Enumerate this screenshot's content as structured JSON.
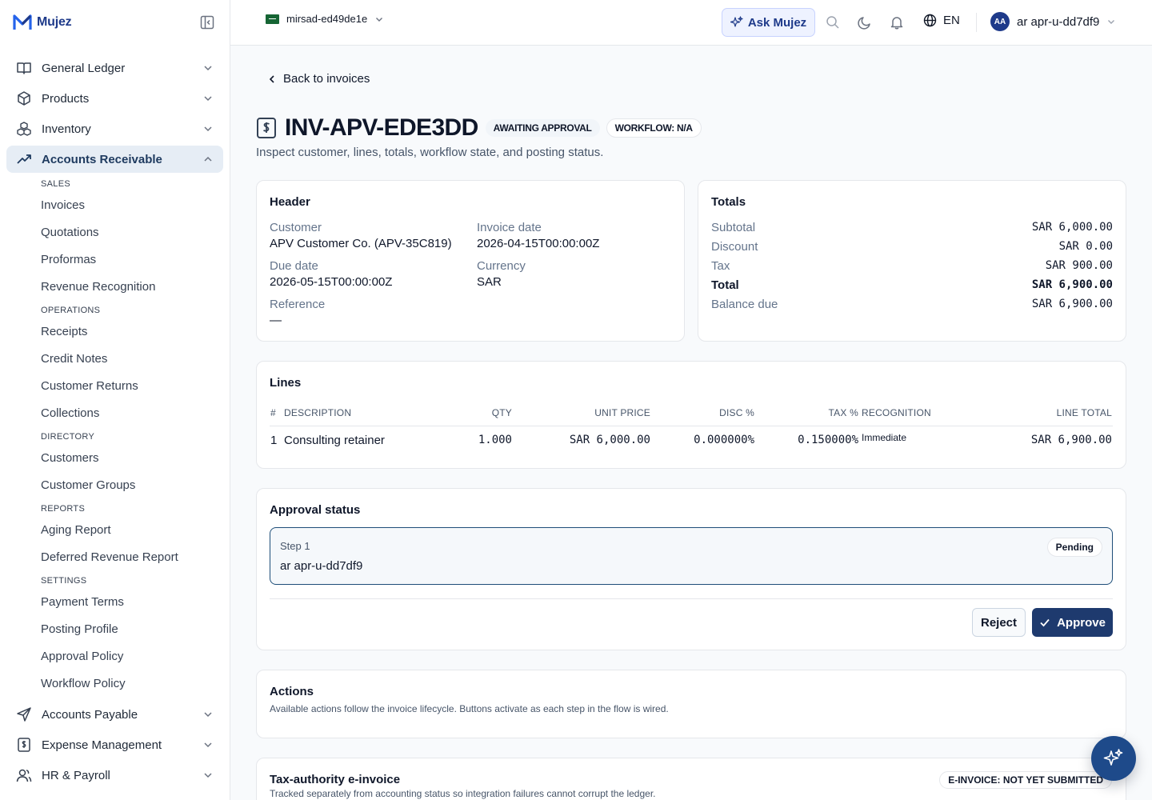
{
  "brand": {
    "name": "Mujez"
  },
  "sidebar": {
    "items": [
      {
        "label": "General Ledger",
        "icon": "book-icon"
      },
      {
        "label": "Products",
        "icon": "box-icon"
      },
      {
        "label": "Inventory",
        "icon": "boxes-icon"
      },
      {
        "label": "Accounts Receivable",
        "icon": "trending-up-icon",
        "active": true
      }
    ],
    "ar_groups": [
      {
        "label": "SALES",
        "items": [
          "Invoices",
          "Quotations",
          "Proformas",
          "Revenue Recognition"
        ]
      },
      {
        "label": "OPERATIONS",
        "items": [
          "Receipts",
          "Credit Notes",
          "Customer Returns",
          "Collections"
        ]
      },
      {
        "label": "DIRECTORY",
        "items": [
          "Customers",
          "Customer Groups"
        ]
      },
      {
        "label": "REPORTS",
        "items": [
          "Aging Report",
          "Deferred Revenue Report"
        ]
      },
      {
        "label": "SETTINGS",
        "items": [
          "Payment Terms",
          "Posting Profile",
          "Approval Policy",
          "Workflow Policy"
        ]
      }
    ],
    "bottom_items": [
      {
        "label": "Accounts Payable",
        "icon": "send-icon"
      },
      {
        "label": "Expense Management",
        "icon": "receipt-icon"
      },
      {
        "label": "HR & Payroll",
        "icon": "users-icon"
      }
    ]
  },
  "topbar": {
    "org": "mirsad-ed49de1e",
    "ask_label": "Ask Mujez",
    "language": "EN",
    "avatar_initials": "AA",
    "user_name": "ar apr-u-dd7df9"
  },
  "page": {
    "back_label": "Back to invoices",
    "title": "INV-APV-EDE3DD",
    "status_badge": "AWAITING APPROVAL",
    "workflow_badge": "WORKFLOW: N/A",
    "subtitle": "Inspect customer, lines, totals, workflow state, and posting status."
  },
  "header_card": {
    "title": "Header",
    "customer_label": "Customer",
    "customer_value": "APV Customer Co. (APV-35C819)",
    "invoice_date_label": "Invoice date",
    "invoice_date_value": "2026-04-15T00:00:00Z",
    "due_date_label": "Due date",
    "due_date_value": "2026-05-15T00:00:00Z",
    "currency_label": "Currency",
    "currency_value": "SAR",
    "reference_label": "Reference",
    "reference_value": "—"
  },
  "totals_card": {
    "title": "Totals",
    "rows": [
      {
        "label": "Subtotal",
        "value": "SAR 6,000.00"
      },
      {
        "label": "Discount",
        "value": "SAR 0.00"
      },
      {
        "label": "Tax",
        "value": "SAR 900.00"
      },
      {
        "label": "Total",
        "value": "SAR 6,900.00"
      },
      {
        "label": "Balance due",
        "value": "SAR 6,900.00"
      }
    ]
  },
  "lines_card": {
    "title": "Lines",
    "columns": [
      "#",
      "DESCRIPTION",
      "QTY",
      "UNIT PRICE",
      "DISC %",
      "TAX %",
      "RECOGNITION",
      "LINE TOTAL"
    ],
    "rows": [
      {
        "num": "1",
        "description": "Consulting retainer",
        "qty": "1.000",
        "unit_price": "SAR 6,000.00",
        "disc": "0.000000%",
        "tax": "0.150000%",
        "recognition": "Immediate",
        "line_total": "SAR 6,900.00"
      }
    ]
  },
  "approval_card": {
    "title": "Approval status",
    "step_label": "Step 1",
    "step_status": "Pending",
    "approver": "ar apr-u-dd7df9",
    "reject_label": "Reject",
    "approve_label": "Approve"
  },
  "actions_card": {
    "title": "Actions",
    "description": "Available actions follow the invoice lifecycle. Buttons activate as each step in the flow is wired."
  },
  "einvoice_card": {
    "title": "Tax-authority e-invoice",
    "badge": "E-INVOICE: NOT YET SUBMITTED",
    "description": "Tracked separately from accounting status so integration failures cannot corrupt the ledger."
  },
  "colors": {
    "brand": "#1e3a8a",
    "accent": "#1e3a6e",
    "active_bg": "#e6edf5"
  }
}
